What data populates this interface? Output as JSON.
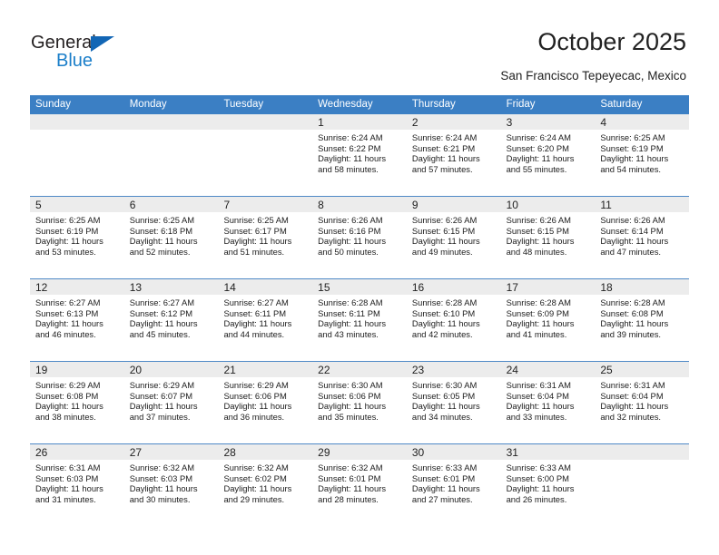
{
  "brand": {
    "name_part1": "General",
    "name_part2": "Blue",
    "triangle_color": "#1266b5",
    "blue_color": "#1a7ec9"
  },
  "header": {
    "title": "October 2025",
    "subtitle": "San Francisco Tepeyecac, Mexico"
  },
  "colors": {
    "weekday_header_bg": "#3b7fc4",
    "weekday_header_text": "#ffffff",
    "daynum_band_bg": "#ececec",
    "row_separator": "#4f89c6",
    "cell_bg": "#ffffff"
  },
  "calendar": {
    "weekdays": [
      "Sunday",
      "Monday",
      "Tuesday",
      "Wednesday",
      "Thursday",
      "Friday",
      "Saturday"
    ],
    "weeks": [
      [
        {
          "day": "",
          "empty": true
        },
        {
          "day": "",
          "empty": true
        },
        {
          "day": "",
          "empty": true
        },
        {
          "day": "1",
          "sunrise": "Sunrise: 6:24 AM",
          "sunset": "Sunset: 6:22 PM",
          "daylight1": "Daylight: 11 hours",
          "daylight2": "and 58 minutes."
        },
        {
          "day": "2",
          "sunrise": "Sunrise: 6:24 AM",
          "sunset": "Sunset: 6:21 PM",
          "daylight1": "Daylight: 11 hours",
          "daylight2": "and 57 minutes."
        },
        {
          "day": "3",
          "sunrise": "Sunrise: 6:24 AM",
          "sunset": "Sunset: 6:20 PM",
          "daylight1": "Daylight: 11 hours",
          "daylight2": "and 55 minutes."
        },
        {
          "day": "4",
          "sunrise": "Sunrise: 6:25 AM",
          "sunset": "Sunset: 6:19 PM",
          "daylight1": "Daylight: 11 hours",
          "daylight2": "and 54 minutes."
        }
      ],
      [
        {
          "day": "5",
          "sunrise": "Sunrise: 6:25 AM",
          "sunset": "Sunset: 6:19 PM",
          "daylight1": "Daylight: 11 hours",
          "daylight2": "and 53 minutes."
        },
        {
          "day": "6",
          "sunrise": "Sunrise: 6:25 AM",
          "sunset": "Sunset: 6:18 PM",
          "daylight1": "Daylight: 11 hours",
          "daylight2": "and 52 minutes."
        },
        {
          "day": "7",
          "sunrise": "Sunrise: 6:25 AM",
          "sunset": "Sunset: 6:17 PM",
          "daylight1": "Daylight: 11 hours",
          "daylight2": "and 51 minutes."
        },
        {
          "day": "8",
          "sunrise": "Sunrise: 6:26 AM",
          "sunset": "Sunset: 6:16 PM",
          "daylight1": "Daylight: 11 hours",
          "daylight2": "and 50 minutes."
        },
        {
          "day": "9",
          "sunrise": "Sunrise: 6:26 AM",
          "sunset": "Sunset: 6:15 PM",
          "daylight1": "Daylight: 11 hours",
          "daylight2": "and 49 minutes."
        },
        {
          "day": "10",
          "sunrise": "Sunrise: 6:26 AM",
          "sunset": "Sunset: 6:15 PM",
          "daylight1": "Daylight: 11 hours",
          "daylight2": "and 48 minutes."
        },
        {
          "day": "11",
          "sunrise": "Sunrise: 6:26 AM",
          "sunset": "Sunset: 6:14 PM",
          "daylight1": "Daylight: 11 hours",
          "daylight2": "and 47 minutes."
        }
      ],
      [
        {
          "day": "12",
          "sunrise": "Sunrise: 6:27 AM",
          "sunset": "Sunset: 6:13 PM",
          "daylight1": "Daylight: 11 hours",
          "daylight2": "and 46 minutes."
        },
        {
          "day": "13",
          "sunrise": "Sunrise: 6:27 AM",
          "sunset": "Sunset: 6:12 PM",
          "daylight1": "Daylight: 11 hours",
          "daylight2": "and 45 minutes."
        },
        {
          "day": "14",
          "sunrise": "Sunrise: 6:27 AM",
          "sunset": "Sunset: 6:11 PM",
          "daylight1": "Daylight: 11 hours",
          "daylight2": "and 44 minutes."
        },
        {
          "day": "15",
          "sunrise": "Sunrise: 6:28 AM",
          "sunset": "Sunset: 6:11 PM",
          "daylight1": "Daylight: 11 hours",
          "daylight2": "and 43 minutes."
        },
        {
          "day": "16",
          "sunrise": "Sunrise: 6:28 AM",
          "sunset": "Sunset: 6:10 PM",
          "daylight1": "Daylight: 11 hours",
          "daylight2": "and 42 minutes."
        },
        {
          "day": "17",
          "sunrise": "Sunrise: 6:28 AM",
          "sunset": "Sunset: 6:09 PM",
          "daylight1": "Daylight: 11 hours",
          "daylight2": "and 41 minutes."
        },
        {
          "day": "18",
          "sunrise": "Sunrise: 6:28 AM",
          "sunset": "Sunset: 6:08 PM",
          "daylight1": "Daylight: 11 hours",
          "daylight2": "and 39 minutes."
        }
      ],
      [
        {
          "day": "19",
          "sunrise": "Sunrise: 6:29 AM",
          "sunset": "Sunset: 6:08 PM",
          "daylight1": "Daylight: 11 hours",
          "daylight2": "and 38 minutes."
        },
        {
          "day": "20",
          "sunrise": "Sunrise: 6:29 AM",
          "sunset": "Sunset: 6:07 PM",
          "daylight1": "Daylight: 11 hours",
          "daylight2": "and 37 minutes."
        },
        {
          "day": "21",
          "sunrise": "Sunrise: 6:29 AM",
          "sunset": "Sunset: 6:06 PM",
          "daylight1": "Daylight: 11 hours",
          "daylight2": "and 36 minutes."
        },
        {
          "day": "22",
          "sunrise": "Sunrise: 6:30 AM",
          "sunset": "Sunset: 6:06 PM",
          "daylight1": "Daylight: 11 hours",
          "daylight2": "and 35 minutes."
        },
        {
          "day": "23",
          "sunrise": "Sunrise: 6:30 AM",
          "sunset": "Sunset: 6:05 PM",
          "daylight1": "Daylight: 11 hours",
          "daylight2": "and 34 minutes."
        },
        {
          "day": "24",
          "sunrise": "Sunrise: 6:31 AM",
          "sunset": "Sunset: 6:04 PM",
          "daylight1": "Daylight: 11 hours",
          "daylight2": "and 33 minutes."
        },
        {
          "day": "25",
          "sunrise": "Sunrise: 6:31 AM",
          "sunset": "Sunset: 6:04 PM",
          "daylight1": "Daylight: 11 hours",
          "daylight2": "and 32 minutes."
        }
      ],
      [
        {
          "day": "26",
          "sunrise": "Sunrise: 6:31 AM",
          "sunset": "Sunset: 6:03 PM",
          "daylight1": "Daylight: 11 hours",
          "daylight2": "and 31 minutes."
        },
        {
          "day": "27",
          "sunrise": "Sunrise: 6:32 AM",
          "sunset": "Sunset: 6:03 PM",
          "daylight1": "Daylight: 11 hours",
          "daylight2": "and 30 minutes."
        },
        {
          "day": "28",
          "sunrise": "Sunrise: 6:32 AM",
          "sunset": "Sunset: 6:02 PM",
          "daylight1": "Daylight: 11 hours",
          "daylight2": "and 29 minutes."
        },
        {
          "day": "29",
          "sunrise": "Sunrise: 6:32 AM",
          "sunset": "Sunset: 6:01 PM",
          "daylight1": "Daylight: 11 hours",
          "daylight2": "and 28 minutes."
        },
        {
          "day": "30",
          "sunrise": "Sunrise: 6:33 AM",
          "sunset": "Sunset: 6:01 PM",
          "daylight1": "Daylight: 11 hours",
          "daylight2": "and 27 minutes."
        },
        {
          "day": "31",
          "sunrise": "Sunrise: 6:33 AM",
          "sunset": "Sunset: 6:00 PM",
          "daylight1": "Daylight: 11 hours",
          "daylight2": "and 26 minutes."
        },
        {
          "day": "",
          "empty": true
        }
      ]
    ]
  }
}
